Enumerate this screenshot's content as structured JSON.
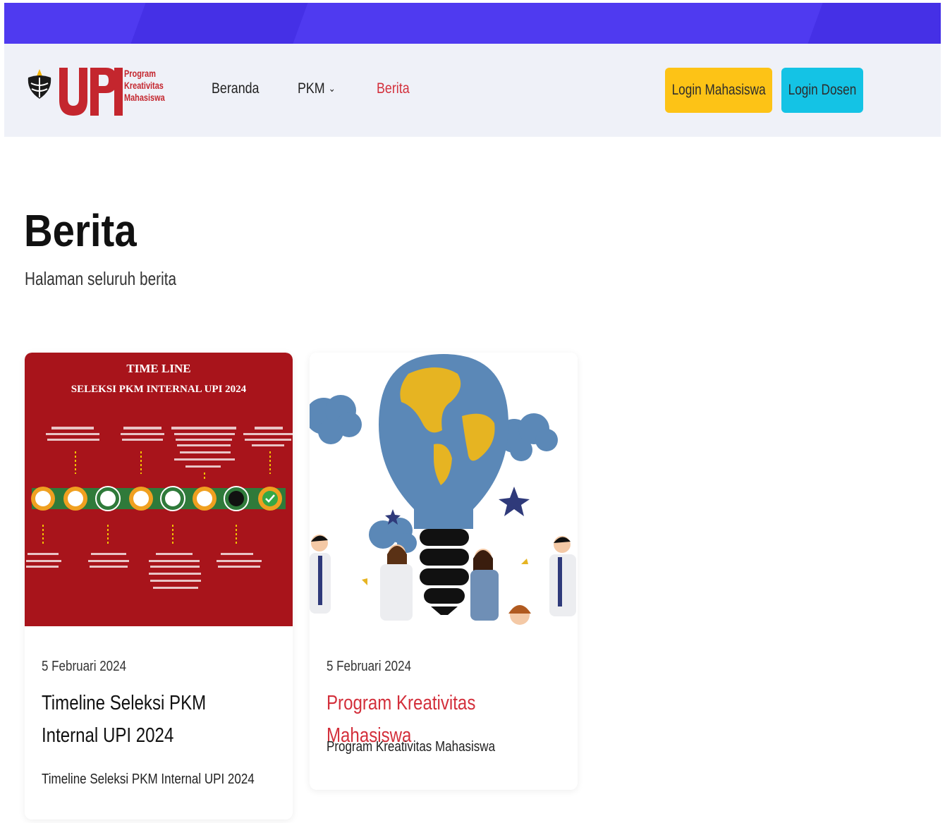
{
  "brand": {
    "logo_text": "UPI",
    "tagline_line1": "Program",
    "tagline_line2": "Kreativitas",
    "tagline_line3": "Mahasiswa",
    "primary_red": "#c4262e",
    "accent_purple": "#4f3af0"
  },
  "nav": {
    "items": [
      {
        "label": "Beranda",
        "active": false
      },
      {
        "label": "PKM",
        "active": false,
        "has_dropdown": true
      },
      {
        "label": "Berita",
        "active": true
      }
    ],
    "login_mahasiswa": "Login Mahasiswa",
    "login_dosen": "Login Dosen",
    "chevron_icon": "chevron-down-icon"
  },
  "page": {
    "title": "Berita",
    "subtitle": "Halaman seluruh berita"
  },
  "news": [
    {
      "image_title_line1": "TIME LINE",
      "image_title_line2": "SELEKSI PKM INTERNAL UPI 2024",
      "date": "5 Februari 2024",
      "title": "Timeline Seleksi PKM Internal UPI 2024",
      "description": "Timeline Seleksi PKM Internal UPI 2024"
    },
    {
      "date": "5 Februari 2024",
      "title": "Program Kreativitas Mahasiswa",
      "description": "Program Kreativitas Mahasiswa"
    }
  ]
}
